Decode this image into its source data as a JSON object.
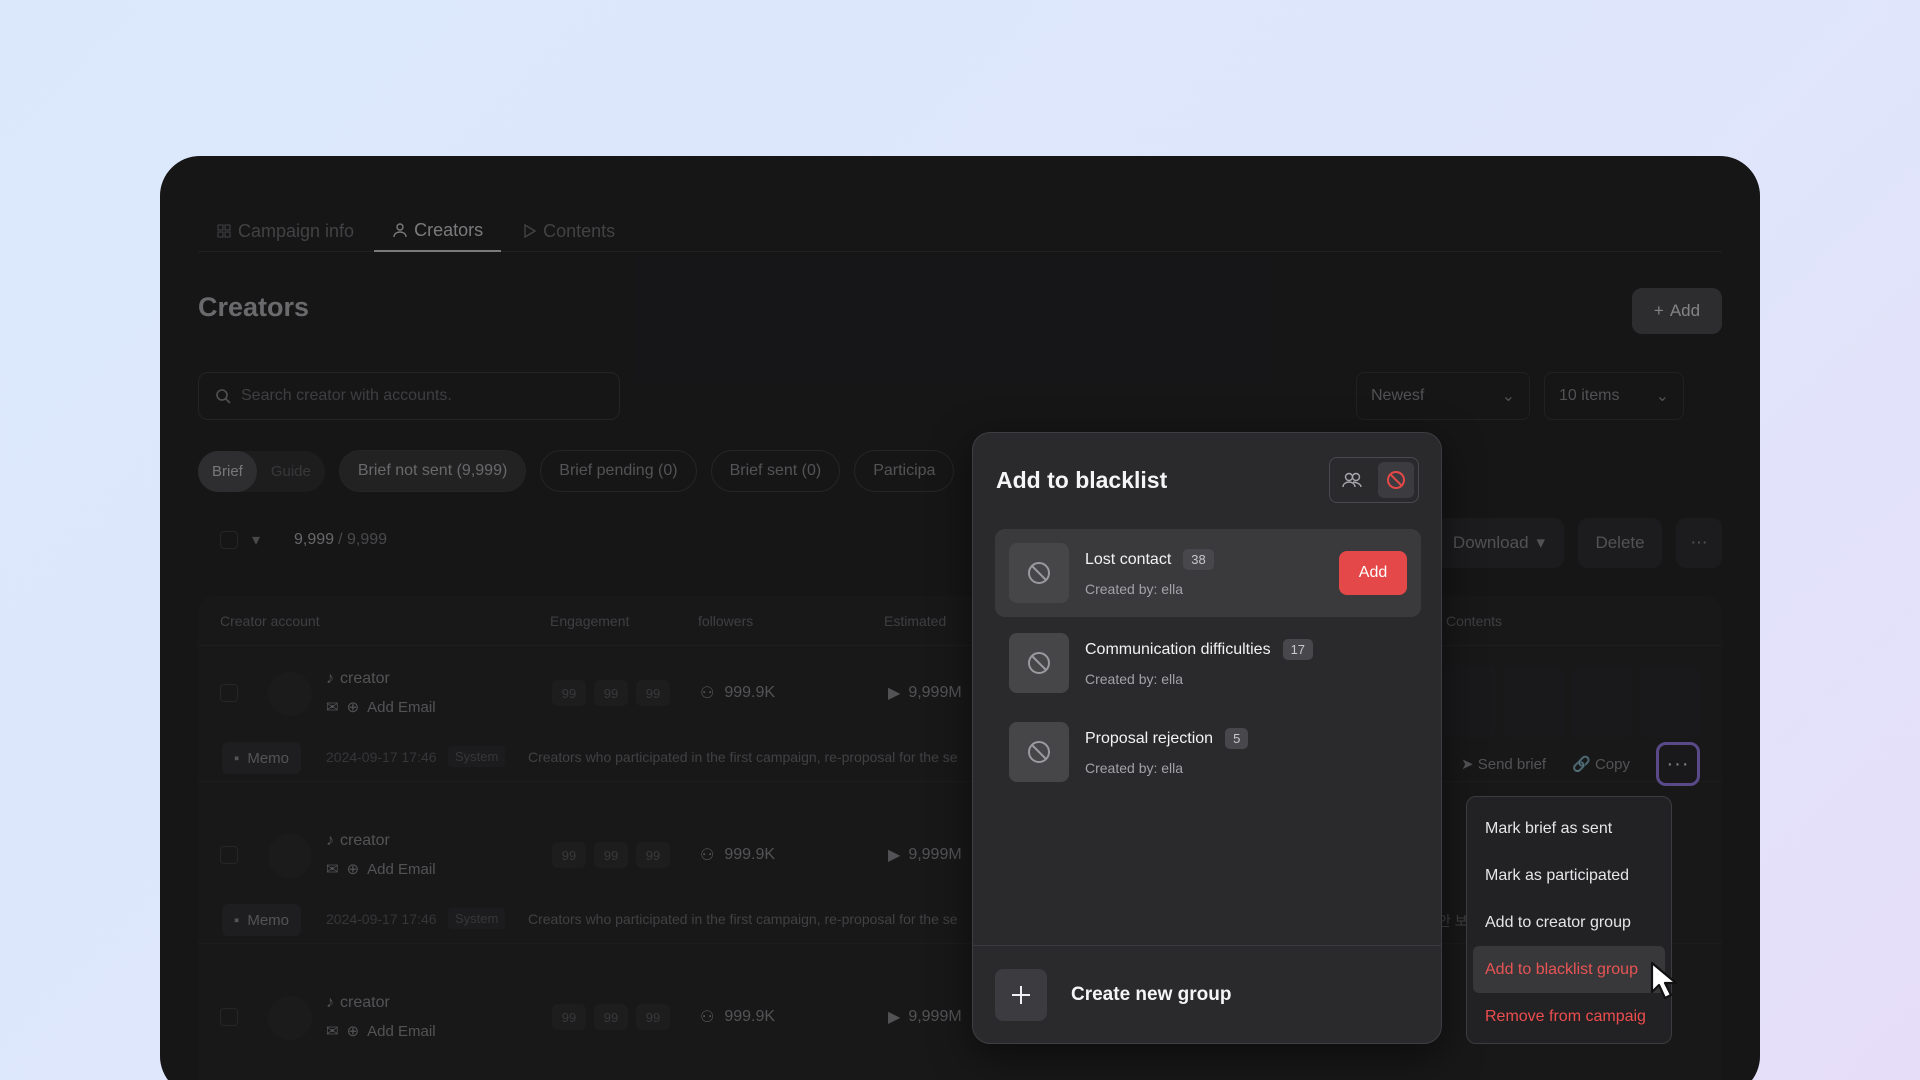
{
  "tabs": [
    {
      "label": "Campaign info"
    },
    {
      "label": "Creators"
    },
    {
      "label": "Contents"
    }
  ],
  "page": {
    "title": "Creators",
    "add_label": "Add"
  },
  "search": {
    "placeholder": "Search creator with accounts."
  },
  "sort": {
    "value": "Newesf"
  },
  "page_size": {
    "value": "10 items"
  },
  "segments": {
    "brief": "Brief",
    "guide": "Guide"
  },
  "filters": [
    "Brief not sent (9,999)",
    "Brief pending (0)",
    "Brief sent (0)",
    "Participa"
  ],
  "selection": {
    "count": "9,999",
    "total": "/ 9,999"
  },
  "actions": {
    "download": "Download",
    "delete": "Delete"
  },
  "table": {
    "headers": {
      "creator_account": "Creator account",
      "engagement": "Engagement",
      "followers": "followers",
      "estimated": "Estimated",
      "contents": "Contents"
    },
    "rows": [
      {
        "name": "creator",
        "add_email": "Add Email",
        "chips": [
          "99",
          "99",
          "99"
        ],
        "followers": "999.9K",
        "estimated": "9,999M"
      },
      {
        "name": "creator",
        "add_email": "Add Email",
        "chips": [
          "99",
          "99",
          "99"
        ],
        "followers": "999.9K",
        "estimated": "9,999M"
      },
      {
        "name": "creator",
        "add_email": "Add Email",
        "chips": [
          "99",
          "99",
          "99"
        ],
        "followers": "999.9K",
        "estimated": "9,999M"
      }
    ],
    "memo": {
      "tag": "Memo",
      "date": "2024-09-17 17:46",
      "system": "System",
      "text": "Creators who participated in the first campaign, re-proposal for the se"
    },
    "row_actions": {
      "send_brief": "Send brief",
      "copy": "Copy",
      "more": "···"
    },
    "memo2_fragment": "안 보"
  },
  "modal": {
    "title": "Add to blacklist",
    "groups": [
      {
        "name": "Lost contact",
        "count": "38",
        "created_by": "Created by: ella",
        "add_label": "Add"
      },
      {
        "name": "Communication difficulties",
        "count": "17",
        "created_by": "Created by: ella"
      },
      {
        "name": "Proposal rejection",
        "count": "5",
        "created_by": "Created by: ella"
      }
    ],
    "create_label": "Create new group"
  },
  "menu": {
    "items": [
      "Mark brief as sent",
      "Mark as participated",
      "Add to creator group",
      "Add to blacklist group",
      "Remove from campaig"
    ]
  },
  "colors": {
    "accent_red": "#e54848",
    "focus_purple": "#9b7df0",
    "background": "#dbe8fb"
  }
}
